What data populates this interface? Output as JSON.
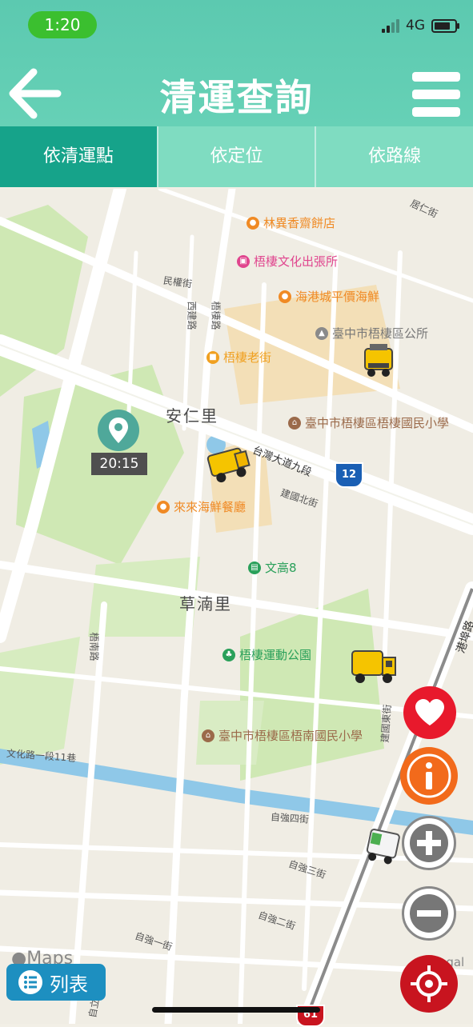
{
  "status_bar": {
    "time": "1:20",
    "network": "4G",
    "battery_level": 0.8
  },
  "header": {
    "title": "清運查詢",
    "back_icon": "arrow-left-icon",
    "menu_icon": "hamburger-icon"
  },
  "tabs": [
    {
      "label": "依清運點",
      "active": true
    },
    {
      "label": "依定位",
      "active": false
    },
    {
      "label": "依路線",
      "active": false
    }
  ],
  "map": {
    "places": [
      {
        "label": "林異香齋餅店",
        "color": "#f08a24"
      },
      {
        "label": "梧棲文化出張所",
        "color": "#e0458e"
      },
      {
        "label": "海港城平價海鮮",
        "color": "#f08a24"
      },
      {
        "label": "臺中市梧棲區公所",
        "color": "#8a8a8a"
      },
      {
        "label": "梧棲老街",
        "color": "#f0a020"
      },
      {
        "label": "臺中市梧棲區梧棲國民小學",
        "color": "#9b6a4a"
      },
      {
        "label": "來來海鮮餐廳",
        "color": "#f08a24"
      },
      {
        "label": "文高8",
        "color": "#2aa05a"
      },
      {
        "label": "梧棲運動公園",
        "color": "#2aa05a"
      },
      {
        "label": "臺中市梧棲區梧南國民小學",
        "color": "#9b6a4a"
      }
    ],
    "districts": [
      "安仁里",
      "草湳里"
    ],
    "roads": [
      "居仁街",
      "民權街",
      "西建路",
      "梧棲路",
      "台灣大道九段",
      "建國北街",
      "梧南路",
      "港埠路",
      "建國東街",
      "文化路一段11巷",
      "自強四街",
      "自強三街",
      "自強二街",
      "自強一街",
      "自立街"
    ],
    "highway_shields": [
      "12",
      "61"
    ],
    "collection_point": {
      "time": "20:15"
    },
    "logo": "Maps",
    "legal": "Legal"
  },
  "buttons": {
    "favorite_icon": "heart-icon",
    "info_icon": "info-icon",
    "zoom_in_icon": "plus-icon",
    "zoom_out_icon": "minus-icon",
    "locate_icon": "crosshair-icon",
    "list_label": "列表"
  },
  "colors": {
    "header": "#5cc9b0",
    "tab_active": "#16a38a",
    "tab_inactive": "#7fdcc1",
    "favorite": "#e8192c",
    "info": "#f26a1b",
    "locate": "#c8141f",
    "list": "#1d8fc0"
  }
}
